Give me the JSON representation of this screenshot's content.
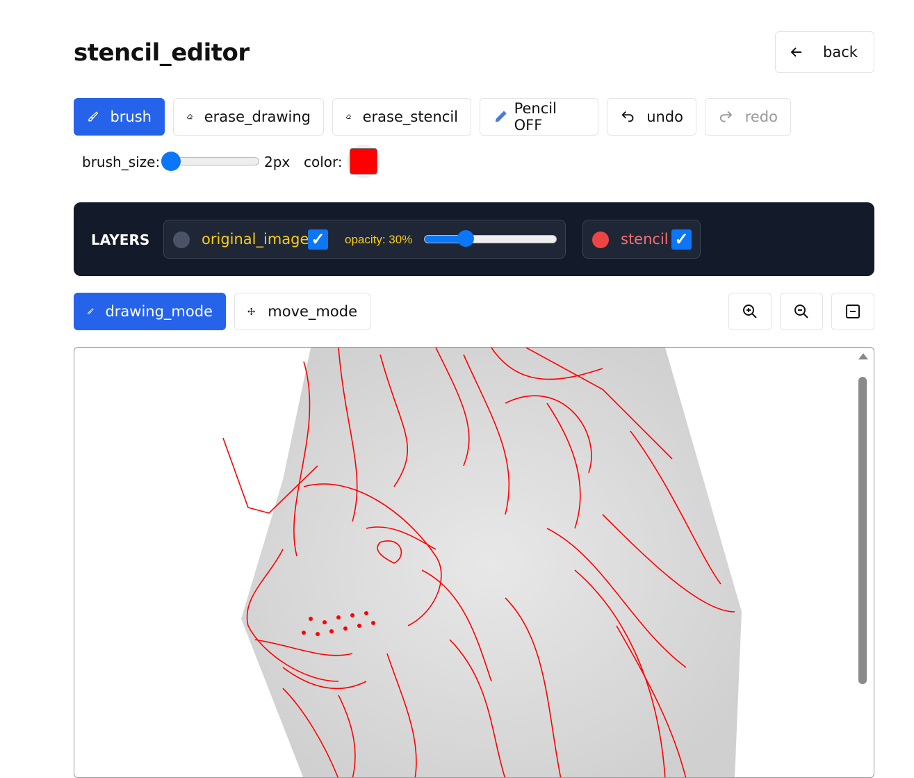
{
  "header": {
    "title": "stencil_editor",
    "back_label": "back"
  },
  "toolbar": {
    "brush": "brush",
    "erase_drawing": "erase_drawing",
    "erase_stencil": "erase_stencil",
    "pencil": "Pencil OFF",
    "undo": "undo",
    "redo": "redo"
  },
  "brush": {
    "size_label": "brush_size:",
    "size_value": "2px",
    "size_fraction": 0.05,
    "color_label": "color:",
    "color": "#ff0000"
  },
  "layers": {
    "title": "LAYERS",
    "original_image": {
      "label": "original_image",
      "checked": true,
      "opacity_label": "opacity: 30%",
      "opacity": 30
    },
    "stencil": {
      "label": "stencil",
      "checked": true
    }
  },
  "modes": {
    "drawing": "drawing_mode",
    "move": "move_mode"
  },
  "colors": {
    "accent": "#2563eb",
    "panel": "#131a29",
    "stencil_line": "#ff0000",
    "original_label": "#facc15",
    "stencil_label": "#f87171"
  }
}
